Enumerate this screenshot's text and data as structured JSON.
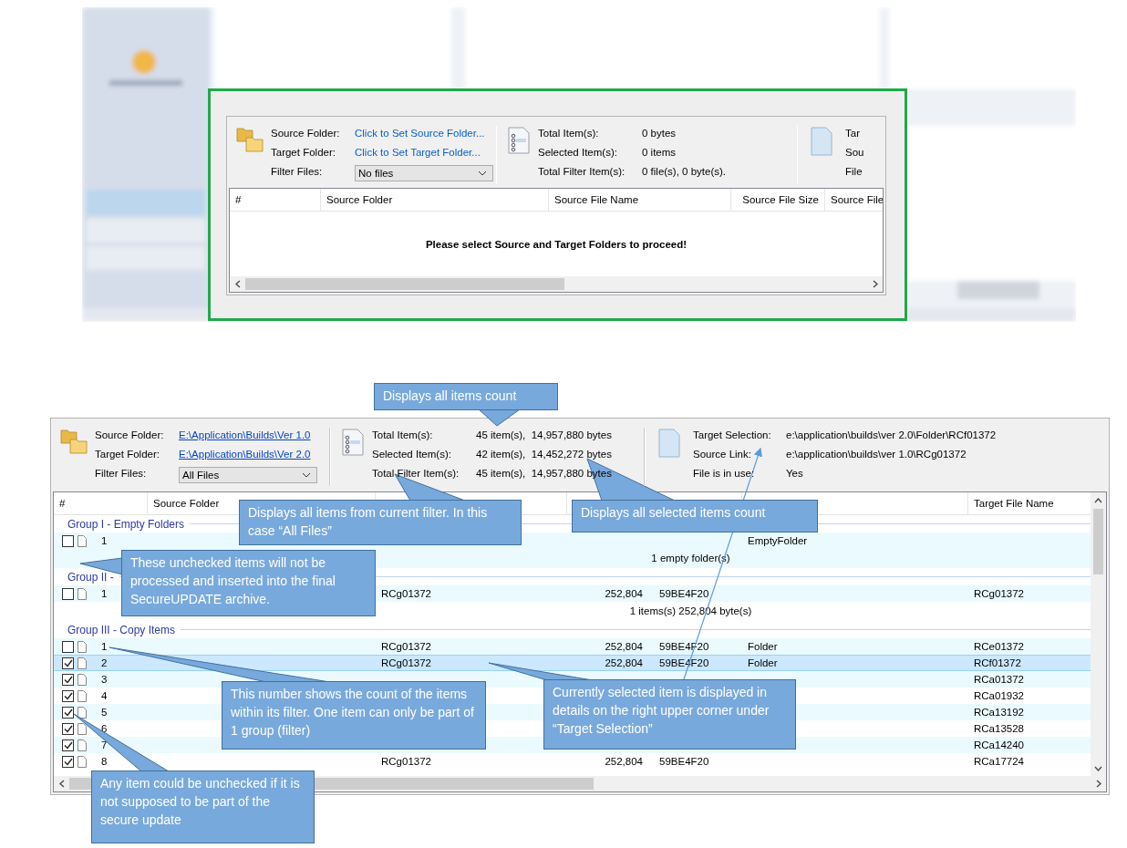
{
  "top_panel": {
    "header": {
      "fields": [
        {
          "label": "Source Folder:",
          "value": "Click to Set Source Folder...",
          "kind": "prompt"
        },
        {
          "label": "Target Folder:",
          "value": "Click to Set Target Folder...",
          "kind": "prompt"
        },
        {
          "label": "Filter Files:",
          "value": "No files",
          "kind": "dropdown"
        }
      ],
      "stats": [
        {
          "label": "Total Item(s):",
          "value": "0 bytes"
        },
        {
          "label": "Selected Item(s):",
          "value": "0 items"
        },
        {
          "label": "Total Filter Item(s):",
          "value": "0 file(s), 0 byte(s)."
        }
      ],
      "details": [
        {
          "label": "Tar"
        },
        {
          "label": "Sou"
        },
        {
          "label": "File"
        }
      ]
    },
    "table": {
      "columns": [
        "#",
        "Source Folder",
        "Source File Name",
        "Source File Size",
        "Source File"
      ],
      "message": "Please select Source and Target Folders to proceed!"
    }
  },
  "bottom_panel": {
    "header": {
      "fields": [
        {
          "label": "Source Folder:",
          "value": "E:\\Application\\Builds\\Ver 1.0",
          "kind": "link"
        },
        {
          "label": "Target Folder:",
          "value": "E:\\Application\\Builds\\Ver 2.0",
          "kind": "link"
        },
        {
          "label": "Filter Files:",
          "value": "All Files",
          "kind": "dropdown"
        }
      ],
      "stats": [
        {
          "label": "Total Item(s):",
          "value": "45 item(s),  14,957,880 bytes"
        },
        {
          "label": "Selected Item(s):",
          "value": "42 item(s),  14,452,272 bytes"
        },
        {
          "label": "Total Filter Item(s):",
          "value": "45 item(s),  14,957,880 bytes"
        }
      ],
      "details": [
        {
          "label": "Target Selection:",
          "value": "e:\\application\\builds\\ver 2.0\\Folder\\RCf01372"
        },
        {
          "label": "Source Link:",
          "value": "e:\\application\\builds\\ver 1.0\\RCg01372"
        },
        {
          "label": "File is in use:",
          "value": "Yes"
        }
      ]
    },
    "table": {
      "columns": {
        "number": "#",
        "source_folder": "Source Folder",
        "target_file_name": "Target File Name"
      },
      "groups": [
        {
          "title": "Group  I - Empty Folders",
          "summary": "1 empty folder(s)",
          "items": [
            {
              "number": "1",
              "checked": false,
              "selected": false,
              "target_folder": "EmptyFolder"
            }
          ]
        },
        {
          "title": "Group  II -",
          "summary": "1 items(s) 252,804 byte(s)",
          "items": [
            {
              "number": "1",
              "checked": false,
              "selected": false,
              "source_file_name": "RCg01372",
              "source_file_size": "252,804",
              "source_file_crc": "59BE4F20",
              "target_file_name": "RCg01372"
            }
          ]
        },
        {
          "title": "Group III - Copy Items",
          "items": [
            {
              "number": "1",
              "checked": false,
              "selected": false,
              "source_file_name": "RCg01372",
              "source_file_size": "252,804",
              "source_file_crc": "59BE4F20",
              "target_folder": "Folder",
              "target_file_name": "RCe01372"
            },
            {
              "number": "2",
              "checked": true,
              "selected": true,
              "source_file_name": "RCg01372",
              "source_file_size": "252,804",
              "source_file_crc": "59BE4F20",
              "target_folder": "Folder",
              "target_file_name": "RCf01372"
            },
            {
              "number": "3",
              "checked": true,
              "selected": false,
              "target_file_name": "RCa01372"
            },
            {
              "number": "4",
              "checked": true,
              "selected": false,
              "target_file_name": "RCa01932"
            },
            {
              "number": "5",
              "checked": true,
              "selected": false,
              "target_file_name": "RCa13192"
            },
            {
              "number": "6",
              "checked": true,
              "selected": false,
              "target_file_name": "RCa13528"
            },
            {
              "number": "7",
              "checked": true,
              "selected": false,
              "target_file_name": "RCa14240"
            },
            {
              "number": "8",
              "checked": true,
              "selected": false,
              "source_file_name": "RCg01372",
              "source_file_size": "252,804",
              "source_file_crc": "59BE4F20",
              "target_file_name": "RCa17724"
            }
          ]
        }
      ]
    }
  },
  "callouts": [
    {
      "text": "Displays all items count"
    },
    {
      "text": "Displays all items from current filter. In this case “All Files”"
    },
    {
      "text": "Displays all selected items count"
    },
    {
      "text": "These unchecked items will not be processed and inserted into the final SecureUPDATE archive."
    },
    {
      "text": "This number shows the count of the items within its filter. One item can only be part of 1 group (filter)"
    },
    {
      "text": "Currently selected item is displayed in details on the right upper corner under “Target Selection”"
    },
    {
      "text": "Any item could be unchecked if it is not supposed to be part of the secure update"
    }
  ]
}
